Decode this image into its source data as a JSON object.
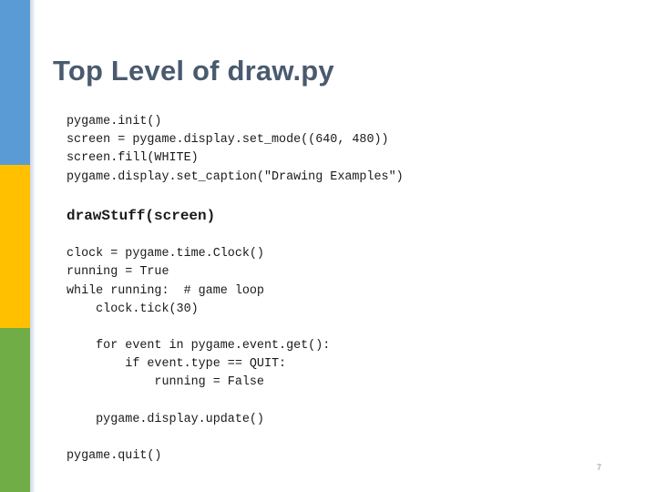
{
  "slide": {
    "title": "Top Level of draw.py",
    "page_number": "7",
    "colors": {
      "title": "#4a5a6f",
      "bar_blue": "#5b9bd5",
      "bar_yellow": "#ffc000",
      "bar_green": "#70ad47"
    },
    "code_block_1": [
      "pygame.init()",
      "screen = pygame.display.set_mode((640, 480))",
      "screen.fill(WHITE)",
      "pygame.display.set_caption(\"Drawing Examples\")"
    ],
    "highlight_line": "drawStuff(screen)",
    "code_block_2": [
      "clock = pygame.time.Clock()",
      "running = True",
      "while running:  # game loop",
      "    clock.tick(30)",
      "",
      "    for event in pygame.event.get():",
      "        if event.type == QUIT:",
      "            running = False",
      "",
      "    pygame.display.update()",
      "",
      "pygame.quit()"
    ]
  }
}
